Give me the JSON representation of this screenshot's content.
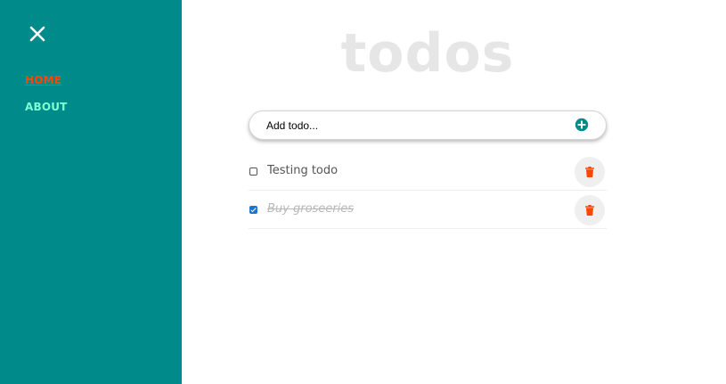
{
  "sidebar": {
    "background": "#008b8b",
    "close_icon": "close-icon",
    "nav": [
      {
        "label": "HOME",
        "active": true,
        "color": "#ff4500"
      },
      {
        "label": "ABOUT",
        "active": false,
        "color": "#7fffd4"
      }
    ]
  },
  "main": {
    "title": "todos",
    "add_form": {
      "placeholder": "Add todo...",
      "value": "",
      "submit_icon": "plus-circle-icon",
      "icon_color": "#008b8b"
    },
    "todos": [
      {
        "text": "Testing todo",
        "completed": false,
        "delete_icon": "trash-icon"
      },
      {
        "text": "Buy groseeries",
        "completed": true,
        "delete_icon": "trash-icon"
      }
    ],
    "delete_icon_color": "#ff4500"
  }
}
